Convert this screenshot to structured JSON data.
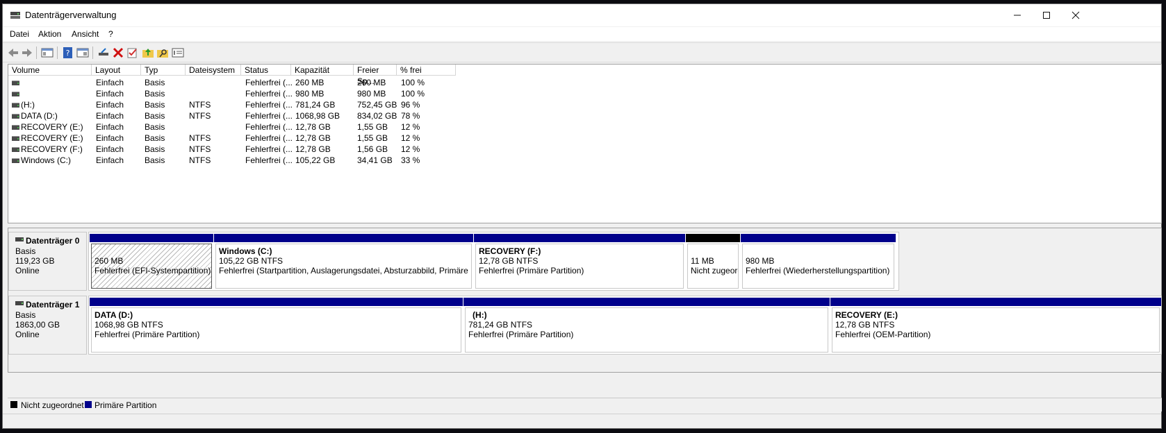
{
  "window": {
    "title": "Datenträgerverwaltung",
    "minimize_icon": "minimize-icon",
    "maximize_icon": "maximize-icon",
    "close_icon": "close-icon"
  },
  "menu": [
    "Datei",
    "Aktion",
    "Ansicht",
    "?"
  ],
  "toolbar": [
    "back-icon",
    "forward-icon",
    "console-tree-icon",
    "help-icon",
    "properties-icon",
    "connect-icon",
    "delete-icon",
    "check-icon",
    "folder-up-icon",
    "search-folder-icon",
    "details-icon"
  ],
  "columns": [
    "Volume",
    "Layout",
    "Typ",
    "Dateisystem",
    "Status",
    "Kapazität",
    "Freier Sp...",
    "% frei"
  ],
  "volumes": [
    {
      "volume": "",
      "layout": "Einfach",
      "typ": "Basis",
      "fs": "",
      "status": "Fehlerfrei (...",
      "cap": "260 MB",
      "free": "260 MB",
      "pct": "100 %"
    },
    {
      "volume": "",
      "layout": "Einfach",
      "typ": "Basis",
      "fs": "",
      "status": "Fehlerfrei (...",
      "cap": "980 MB",
      "free": "980 MB",
      "pct": "100 %"
    },
    {
      "volume": "(H:)",
      "layout": "Einfach",
      "typ": "Basis",
      "fs": "NTFS",
      "status": "Fehlerfrei (...",
      "cap": "781,24 GB",
      "free": "752,45 GB",
      "pct": "96 %"
    },
    {
      "volume": "DATA (D:)",
      "layout": "Einfach",
      "typ": "Basis",
      "fs": "NTFS",
      "status": "Fehlerfrei (...",
      "cap": "1068,98 GB",
      "free": "834,02 GB",
      "pct": "78 %"
    },
    {
      "volume": "RECOVERY (E:)",
      "layout": "Einfach",
      "typ": "Basis",
      "fs": "",
      "status": "Fehlerfrei (...",
      "cap": "12,78 GB",
      "free": "1,55 GB",
      "pct": "12 %"
    },
    {
      "volume": "RECOVERY (E:)",
      "layout": "Einfach",
      "typ": "Basis",
      "fs": "NTFS",
      "status": "Fehlerfrei (...",
      "cap": "12,78 GB",
      "free": "1,55 GB",
      "pct": "12 %"
    },
    {
      "volume": "RECOVERY (F:)",
      "layout": "Einfach",
      "typ": "Basis",
      "fs": "NTFS",
      "status": "Fehlerfrei (...",
      "cap": "12,78 GB",
      "free": "1,56 GB",
      "pct": "12 %"
    },
    {
      "volume": "Windows (C:)",
      "layout": "Einfach",
      "typ": "Basis",
      "fs": "NTFS",
      "status": "Fehlerfrei (...",
      "cap": "105,22 GB",
      "free": "34,41 GB",
      "pct": "33 %"
    }
  ],
  "disks": [
    {
      "name": "Datenträger 0",
      "type": "Basis",
      "size": "119,23 GB",
      "state": "Online",
      "partitions": [
        {
          "title": "",
          "size": "260 MB",
          "status": "Fehlerfrei (EFI-Systempartition)"
        },
        {
          "title": "Windows  (C:)",
          "size": "105,22 GB NTFS",
          "status": "Fehlerfrei (Startpartition, Auslagerungsdatei, Absturzabbild, Primäre Partition)"
        },
        {
          "title": "RECOVERY  (F:)",
          "size": "12,78 GB NTFS",
          "status": "Fehlerfrei (Primäre Partition)"
        },
        {
          "title": "",
          "size": "11 MB",
          "status": "Nicht zugeordnet"
        },
        {
          "title": "",
          "size": "980 MB",
          "status": "Fehlerfrei (Wiederherstellungspartition)"
        }
      ]
    },
    {
      "name": "Datenträger 1",
      "type": "Basis",
      "size": "1863,00 GB",
      "state": "Online",
      "partitions": [
        {
          "title": "DATA  (D:)",
          "size": "1068,98 GB NTFS",
          "status": "Fehlerfrei (Primäre Partition)"
        },
        {
          "title": "(H:)",
          "size": "781,24 GB NTFS",
          "status": "Fehlerfrei (Primäre Partition)"
        },
        {
          "title": "RECOVERY  (E:)",
          "size": "12,78 GB NTFS",
          "status": "Fehlerfrei (OEM-Partition)"
        }
      ]
    }
  ],
  "legend": [
    {
      "label": "Nicht zugeordnet",
      "color": "#000000"
    },
    {
      "label": "Primäre Partition",
      "color": "#00008b"
    }
  ]
}
